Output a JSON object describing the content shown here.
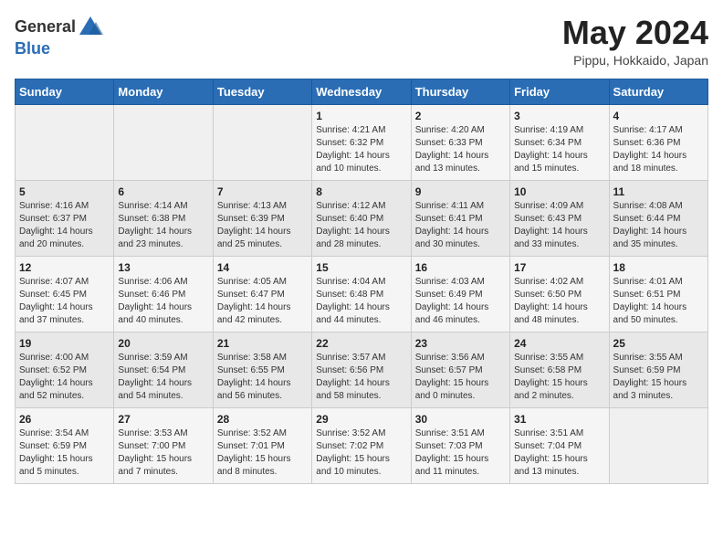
{
  "header": {
    "logo_general": "General",
    "logo_blue": "Blue",
    "month_title": "May 2024",
    "location": "Pippu, Hokkaido, Japan"
  },
  "weekdays": [
    "Sunday",
    "Monday",
    "Tuesday",
    "Wednesday",
    "Thursday",
    "Friday",
    "Saturday"
  ],
  "weeks": [
    [
      {
        "day": "",
        "content": ""
      },
      {
        "day": "",
        "content": ""
      },
      {
        "day": "",
        "content": ""
      },
      {
        "day": "1",
        "content": "Sunrise: 4:21 AM\nSunset: 6:32 PM\nDaylight: 14 hours\nand 10 minutes."
      },
      {
        "day": "2",
        "content": "Sunrise: 4:20 AM\nSunset: 6:33 PM\nDaylight: 14 hours\nand 13 minutes."
      },
      {
        "day": "3",
        "content": "Sunrise: 4:19 AM\nSunset: 6:34 PM\nDaylight: 14 hours\nand 15 minutes."
      },
      {
        "day": "4",
        "content": "Sunrise: 4:17 AM\nSunset: 6:36 PM\nDaylight: 14 hours\nand 18 minutes."
      }
    ],
    [
      {
        "day": "5",
        "content": "Sunrise: 4:16 AM\nSunset: 6:37 PM\nDaylight: 14 hours\nand 20 minutes."
      },
      {
        "day": "6",
        "content": "Sunrise: 4:14 AM\nSunset: 6:38 PM\nDaylight: 14 hours\nand 23 minutes."
      },
      {
        "day": "7",
        "content": "Sunrise: 4:13 AM\nSunset: 6:39 PM\nDaylight: 14 hours\nand 25 minutes."
      },
      {
        "day": "8",
        "content": "Sunrise: 4:12 AM\nSunset: 6:40 PM\nDaylight: 14 hours\nand 28 minutes."
      },
      {
        "day": "9",
        "content": "Sunrise: 4:11 AM\nSunset: 6:41 PM\nDaylight: 14 hours\nand 30 minutes."
      },
      {
        "day": "10",
        "content": "Sunrise: 4:09 AM\nSunset: 6:43 PM\nDaylight: 14 hours\nand 33 minutes."
      },
      {
        "day": "11",
        "content": "Sunrise: 4:08 AM\nSunset: 6:44 PM\nDaylight: 14 hours\nand 35 minutes."
      }
    ],
    [
      {
        "day": "12",
        "content": "Sunrise: 4:07 AM\nSunset: 6:45 PM\nDaylight: 14 hours\nand 37 minutes."
      },
      {
        "day": "13",
        "content": "Sunrise: 4:06 AM\nSunset: 6:46 PM\nDaylight: 14 hours\nand 40 minutes."
      },
      {
        "day": "14",
        "content": "Sunrise: 4:05 AM\nSunset: 6:47 PM\nDaylight: 14 hours\nand 42 minutes."
      },
      {
        "day": "15",
        "content": "Sunrise: 4:04 AM\nSunset: 6:48 PM\nDaylight: 14 hours\nand 44 minutes."
      },
      {
        "day": "16",
        "content": "Sunrise: 4:03 AM\nSunset: 6:49 PM\nDaylight: 14 hours\nand 46 minutes."
      },
      {
        "day": "17",
        "content": "Sunrise: 4:02 AM\nSunset: 6:50 PM\nDaylight: 14 hours\nand 48 minutes."
      },
      {
        "day": "18",
        "content": "Sunrise: 4:01 AM\nSunset: 6:51 PM\nDaylight: 14 hours\nand 50 minutes."
      }
    ],
    [
      {
        "day": "19",
        "content": "Sunrise: 4:00 AM\nSunset: 6:52 PM\nDaylight: 14 hours\nand 52 minutes."
      },
      {
        "day": "20",
        "content": "Sunrise: 3:59 AM\nSunset: 6:54 PM\nDaylight: 14 hours\nand 54 minutes."
      },
      {
        "day": "21",
        "content": "Sunrise: 3:58 AM\nSunset: 6:55 PM\nDaylight: 14 hours\nand 56 minutes."
      },
      {
        "day": "22",
        "content": "Sunrise: 3:57 AM\nSunset: 6:56 PM\nDaylight: 14 hours\nand 58 minutes."
      },
      {
        "day": "23",
        "content": "Sunrise: 3:56 AM\nSunset: 6:57 PM\nDaylight: 15 hours\nand 0 minutes."
      },
      {
        "day": "24",
        "content": "Sunrise: 3:55 AM\nSunset: 6:58 PM\nDaylight: 15 hours\nand 2 minutes."
      },
      {
        "day": "25",
        "content": "Sunrise: 3:55 AM\nSunset: 6:59 PM\nDaylight: 15 hours\nand 3 minutes."
      }
    ],
    [
      {
        "day": "26",
        "content": "Sunrise: 3:54 AM\nSunset: 6:59 PM\nDaylight: 15 hours\nand 5 minutes."
      },
      {
        "day": "27",
        "content": "Sunrise: 3:53 AM\nSunset: 7:00 PM\nDaylight: 15 hours\nand 7 minutes."
      },
      {
        "day": "28",
        "content": "Sunrise: 3:52 AM\nSunset: 7:01 PM\nDaylight: 15 hours\nand 8 minutes."
      },
      {
        "day": "29",
        "content": "Sunrise: 3:52 AM\nSunset: 7:02 PM\nDaylight: 15 hours\nand 10 minutes."
      },
      {
        "day": "30",
        "content": "Sunrise: 3:51 AM\nSunset: 7:03 PM\nDaylight: 15 hours\nand 11 minutes."
      },
      {
        "day": "31",
        "content": "Sunrise: 3:51 AM\nSunset: 7:04 PM\nDaylight: 15 hours\nand 13 minutes."
      },
      {
        "day": "",
        "content": ""
      }
    ]
  ]
}
